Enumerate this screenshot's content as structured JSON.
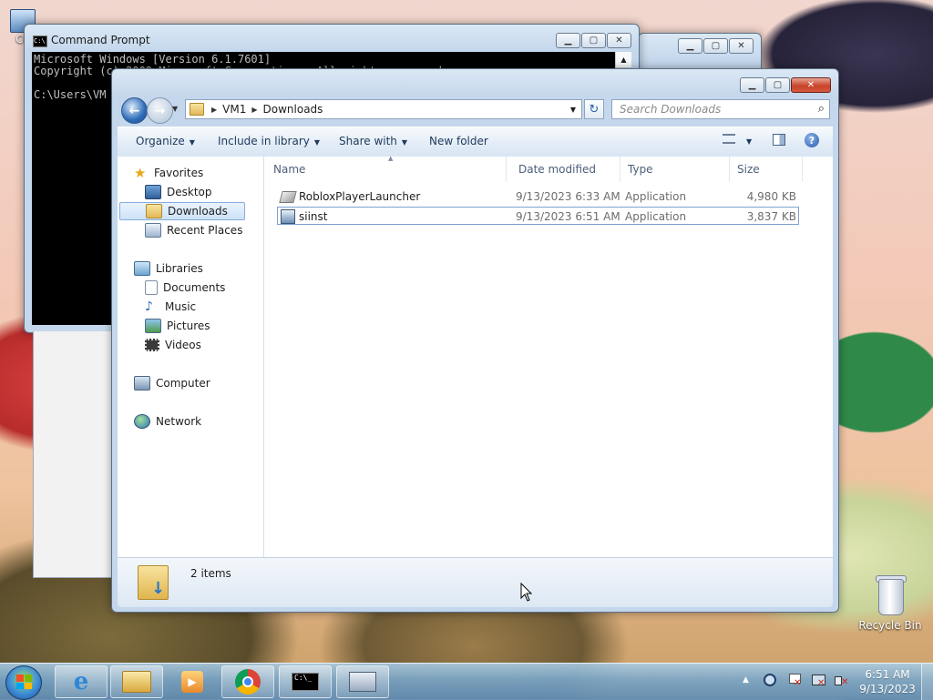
{
  "desktop": {
    "recycle_bin_label": "Recycle Bin",
    "partial_icon_label": "Co"
  },
  "cmd": {
    "title": "Command Prompt",
    "lines": [
      "Microsoft Windows [Version 6.1.7601]",
      "Copyright (c) 2009 Microsoft Corporation.  All rights reserved.",
      "",
      "C:\\Users\\VM"
    ],
    "icon": "cmd-icon"
  },
  "explorer": {
    "breadcrumb": [
      "VM1",
      "Downloads"
    ],
    "search_placeholder": "Search Downloads",
    "toolbar": {
      "organize": "Organize",
      "include": "Include in library",
      "share": "Share with",
      "new_folder": "New folder"
    },
    "nav": {
      "favorites": "Favorites",
      "desktop": "Desktop",
      "downloads": "Downloads",
      "recent": "Recent Places",
      "libraries": "Libraries",
      "documents": "Documents",
      "music": "Music",
      "pictures": "Pictures",
      "videos": "Videos",
      "computer": "Computer",
      "network": "Network"
    },
    "columns": {
      "name": "Name",
      "date": "Date modified",
      "type": "Type",
      "size": "Size"
    },
    "files": [
      {
        "name": "RobloxPlayerLauncher",
        "date": "9/13/2023 6:33 AM",
        "type": "Application",
        "size": "4,980 KB"
      },
      {
        "name": "siinst",
        "date": "9/13/2023 6:51 AM",
        "type": "Application",
        "size": "3,837 KB"
      }
    ],
    "status": "2 items"
  },
  "taskbar": {
    "time": "6:51 AM",
    "date": "9/13/2023"
  },
  "colors": {
    "selection_border": "#84acdd",
    "link_blue": "#1e395b",
    "close_red": "#c7452c"
  }
}
